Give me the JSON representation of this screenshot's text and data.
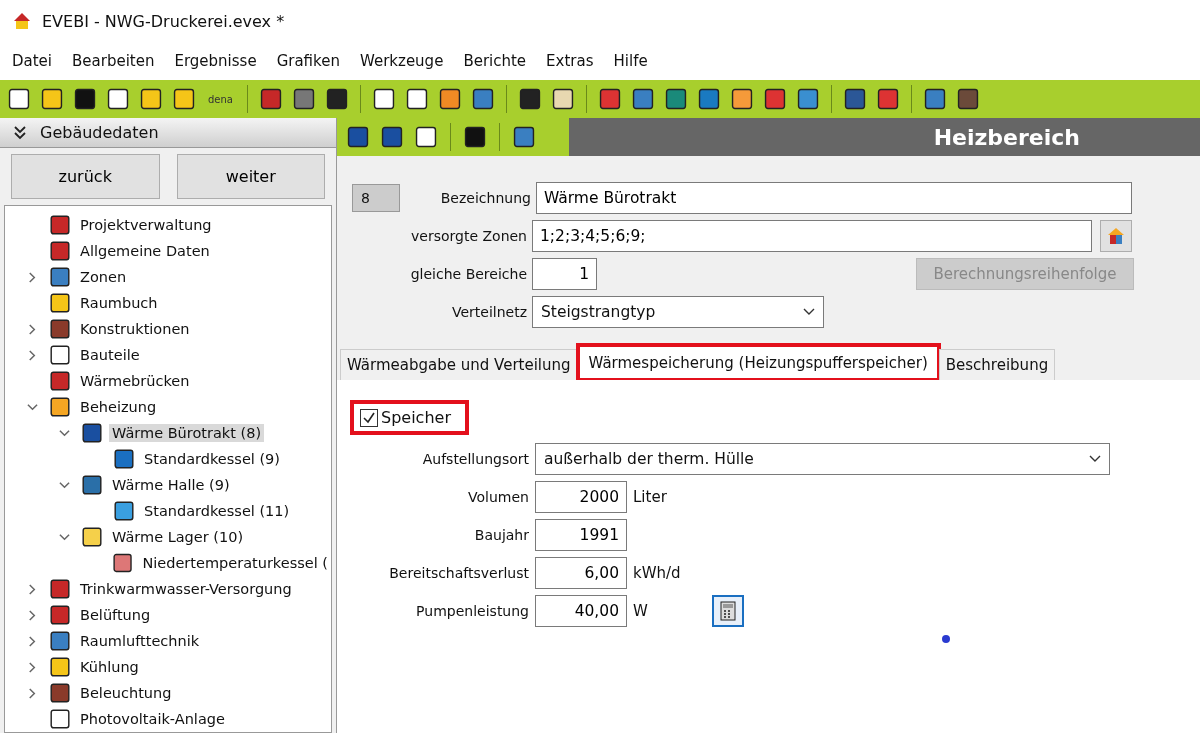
{
  "window": {
    "title": "EVEBI - NWG-Druckerei.evex *"
  },
  "menu": [
    "Datei",
    "Bearbeiten",
    "Ergebnisse",
    "Grafiken",
    "Werkzeuge",
    "Berichte",
    "Extras",
    "Hilfe"
  ],
  "toolbar": {
    "dena_label": "dena"
  },
  "sidebar": {
    "title": "Gebäudedaten",
    "buttons": [
      "zurück",
      "weiter"
    ],
    "tree": [
      {
        "label": "Projektverwaltung",
        "expandable": false,
        "expanded": false,
        "selected": false
      },
      {
        "label": "Allgemeine Daten",
        "expandable": false,
        "expanded": false,
        "selected": false
      },
      {
        "label": "Zonen",
        "expandable": true,
        "expanded": false,
        "selected": false
      },
      {
        "label": "Raumbuch",
        "expandable": false,
        "expanded": false,
        "selected": false
      },
      {
        "label": "Konstruktionen",
        "expandable": true,
        "expanded": false,
        "selected": false
      },
      {
        "label": "Bauteile",
        "expandable": true,
        "expanded": false,
        "selected": false
      },
      {
        "label": "Wärmebrücken",
        "expandable": false,
        "expanded": false,
        "selected": false
      },
      {
        "label": "Beheizung",
        "expandable": true,
        "expanded": true,
        "selected": false,
        "children": [
          {
            "label": "Wärme Bürotrakt (8)",
            "expandable": true,
            "expanded": true,
            "selected": true,
            "children": [
              {
                "label": "Standardkessel (9)",
                "expandable": false,
                "expanded": false,
                "selected": false
              }
            ]
          },
          {
            "label": "Wärme Halle (9)",
            "expandable": true,
            "expanded": true,
            "selected": false,
            "children": [
              {
                "label": "Standardkessel (11)",
                "expandable": false,
                "expanded": false,
                "selected": false
              }
            ]
          },
          {
            "label": "Wärme Lager (10)",
            "expandable": true,
            "expanded": true,
            "selected": false,
            "children": [
              {
                "label": "Niedertemperaturkessel (",
                "expandable": false,
                "expanded": false,
                "selected": false
              }
            ]
          }
        ]
      },
      {
        "label": "Trinkwarmwasser-Versorgung",
        "expandable": true,
        "expanded": false,
        "selected": false
      },
      {
        "label": "Belüftung",
        "expandable": true,
        "expanded": false,
        "selected": false
      },
      {
        "label": "Raumlufttechnik",
        "expandable": true,
        "expanded": false,
        "selected": false
      },
      {
        "label": "Kühlung",
        "expandable": true,
        "expanded": false,
        "selected": false
      },
      {
        "label": "Beleuchtung",
        "expandable": true,
        "expanded": false,
        "selected": false
      },
      {
        "label": "Photovoltaik-Anlage",
        "expandable": false,
        "expanded": false,
        "selected": false
      }
    ]
  },
  "panel": {
    "title": "Heizbereich",
    "id": "8",
    "bezeichnung": {
      "label": "Bezeichnung",
      "value": "Wärme Bürotrakt"
    },
    "zonen": {
      "label": "versorgte Zonen",
      "value": "1;2;3;4;5;6;9;"
    },
    "bereiche": {
      "label": "gleiche Bereiche",
      "value": "1"
    },
    "reihenfolge_button": {
      "label": "Berechnungsreihenfolge",
      "disabled": true
    },
    "verteilnetz": {
      "label": "Verteilnetz",
      "value": "Steigstrangtyp"
    },
    "tabs": [
      {
        "label": "Wärmeabgabe und Verteilung",
        "selected": false,
        "highlighted": false
      },
      {
        "label": "Wärmespeicherung (Heizungspufferspeicher)",
        "selected": true,
        "highlighted": true
      },
      {
        "label": "Beschreibung",
        "selected": false,
        "highlighted": false
      }
    ],
    "speicher": {
      "label": "Speicher",
      "checked": true,
      "highlighted": true
    },
    "fields": [
      {
        "kind": "select",
        "label": "Aufstellungsort",
        "value": "außerhalb der therm. Hülle"
      },
      {
        "kind": "number",
        "label": "Volumen",
        "value": "2000",
        "unit": "Liter"
      },
      {
        "kind": "number",
        "label": "Baujahr",
        "value": "1991"
      },
      {
        "kind": "number",
        "label": "Bereitschaftsverlust",
        "value": "6,00",
        "unit": "kWh/d"
      },
      {
        "kind": "number",
        "label": "Pumpenleistung",
        "value": "40,00",
        "unit": "W",
        "calculator": true
      }
    ]
  }
}
